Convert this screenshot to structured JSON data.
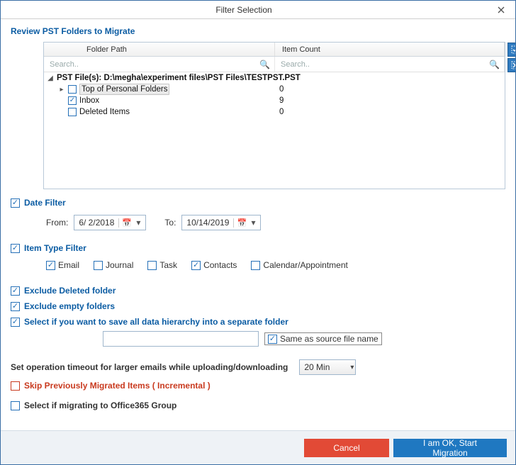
{
  "window": {
    "title": "Filter Selection"
  },
  "review": {
    "label": "Review PST Folders to Migrate",
    "headers": {
      "path": "Folder Path",
      "count": "Item Count"
    },
    "search_placeholder": "Search..",
    "root": {
      "label": "PST File(s): D:\\megha\\experiment files\\PST Files\\TESTPST.PST"
    },
    "rows": [
      {
        "label": "Top of Personal Folders",
        "count": "0",
        "checked": false,
        "selected": true,
        "hasExpander": true
      },
      {
        "label": "Inbox",
        "count": "9",
        "checked": true,
        "selected": false,
        "hasExpander": false
      },
      {
        "label": "Deleted Items",
        "count": "0",
        "checked": false,
        "selected": false,
        "hasExpander": false
      }
    ]
  },
  "dateFilter": {
    "label": "Date Filter",
    "checked": true,
    "from_label": "From:",
    "to_label": "To:",
    "from": "6/  2/2018",
    "to": "10/14/2019"
  },
  "itemType": {
    "label": "Item Type Filter",
    "checked": true,
    "items": [
      {
        "label": "Email",
        "checked": true
      },
      {
        "label": "Journal",
        "checked": false
      },
      {
        "label": "Task",
        "checked": false
      },
      {
        "label": "Contacts",
        "checked": true
      },
      {
        "label": "Calendar/Appointment",
        "checked": false
      }
    ]
  },
  "options": {
    "excludeDeleted": {
      "label": "Exclude Deleted folder",
      "checked": true
    },
    "excludeEmpty": {
      "label": "Exclude empty folders",
      "checked": true
    },
    "separateFolder": {
      "label": "Select if you want to save all data hierarchy into a separate folder",
      "checked": true,
      "value": "",
      "sameAs": {
        "label": "Same as source file name",
        "checked": true
      }
    },
    "timeout": {
      "label": "Set operation timeout for larger emails while uploading/downloading",
      "value": "20 Min"
    },
    "skipMigrated": {
      "label": "Skip Previously Migrated Items ( Incremental )",
      "checked": false
    },
    "o365group": {
      "label": "Select if migrating to Office365 Group",
      "checked": false
    }
  },
  "buttons": {
    "cancel": "Cancel",
    "ok": "I am OK, Start Migration"
  }
}
